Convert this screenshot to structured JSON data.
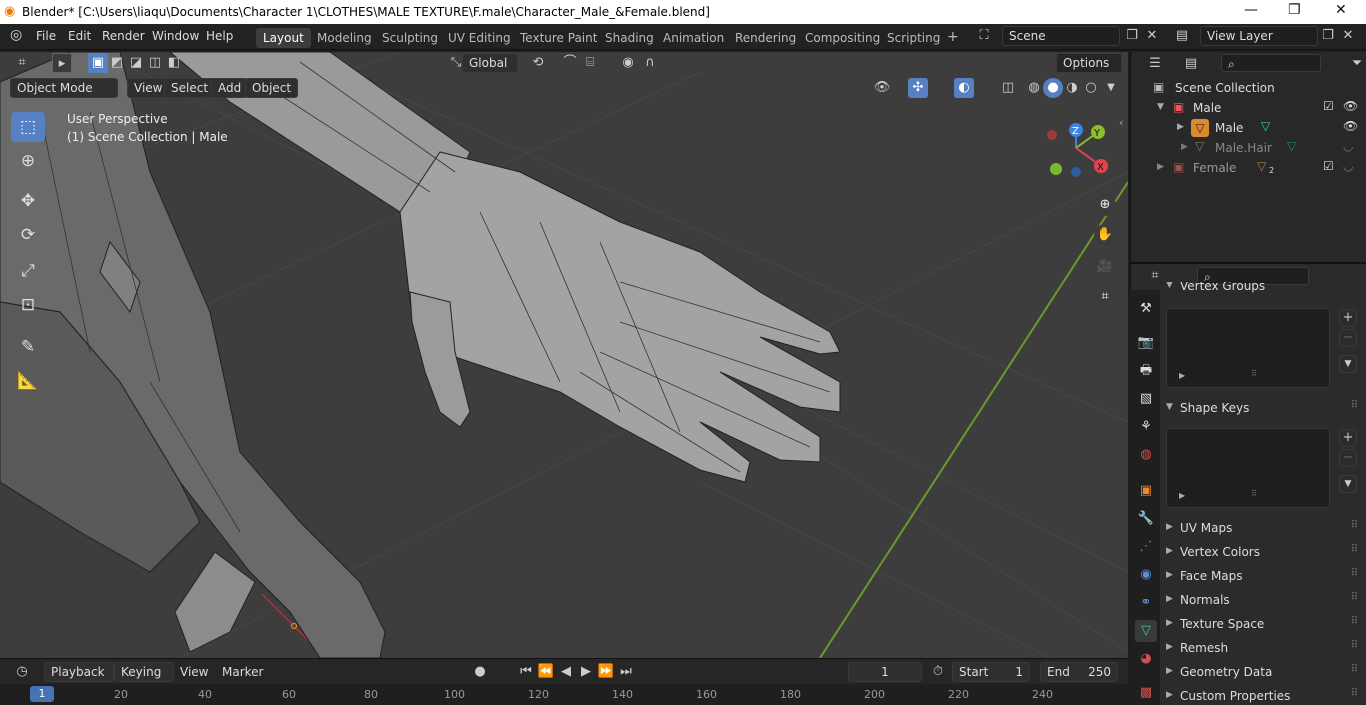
{
  "window": {
    "title": "Blender* [C:\\Users\\liaqu\\Documents\\Character 1\\CLOTHES\\MALE TEXTURE\\F.male\\Character_Male_&Female.blend]",
    "minimize": "—",
    "maximize": "❐",
    "close": "✕"
  },
  "menu": {
    "items": [
      "File",
      "Edit",
      "Render",
      "Window",
      "Help"
    ]
  },
  "workspaces": {
    "tabs": [
      "Layout",
      "Modeling",
      "Sculpting",
      "UV Editing",
      "Texture Paint",
      "Shading",
      "Animation",
      "Rendering",
      "Compositing",
      "Scripting"
    ],
    "active": "Layout",
    "add": "+"
  },
  "scene": {
    "name": "Scene"
  },
  "view_layer": {
    "name": "View Layer"
  },
  "viewport_header": {
    "transform_orientation": "Global",
    "options": "Options",
    "mode": "Object Mode",
    "menus": [
      "View",
      "Select",
      "Add",
      "Object"
    ]
  },
  "viewport": {
    "perspective": "User Perspective",
    "collection": "(1) Scene Collection | Male",
    "gizmo": {
      "x": "X",
      "y": "Y",
      "z": "Z"
    }
  },
  "outliner": {
    "root": "Scene Collection",
    "rows": [
      {
        "label": "Male",
        "kind": "collection"
      },
      {
        "label": "Male",
        "kind": "mesh"
      },
      {
        "label": "Male.Hair",
        "kind": "mesh"
      },
      {
        "label": "Female",
        "kind": "collection",
        "badge": "2"
      }
    ]
  },
  "properties": {
    "vertex_groups": "Vertex Groups",
    "shape_keys": "Shape Keys",
    "sections": [
      "UV Maps",
      "Vertex Colors",
      "Face Maps",
      "Normals",
      "Texture Space",
      "Remesh",
      "Geometry Data",
      "Custom Properties"
    ]
  },
  "timeline": {
    "menus": [
      "Playback",
      "Keying",
      "View",
      "Marker"
    ],
    "current_frame": "1",
    "start_label": "Start",
    "start": "1",
    "end_label": "End",
    "end": "250",
    "ruler": [
      "1",
      "20",
      "40",
      "60",
      "80",
      "100",
      "120",
      "140",
      "160",
      "180",
      "200",
      "220",
      "240"
    ]
  },
  "colors": {
    "accent": "#5680c2",
    "x_axis": "#e2444f",
    "y_axis": "#8bbe2b",
    "z_axis": "#3d85de",
    "grid_green": "#6a9a2a",
    "mesh_shade": "#9a9a9a"
  }
}
